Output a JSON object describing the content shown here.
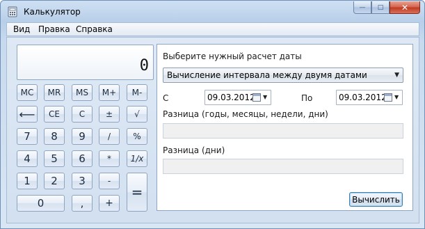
{
  "window": {
    "title": "Калькулятор",
    "caption": {
      "minimize": "—",
      "maximize": "□",
      "close": "✕"
    }
  },
  "menu": {
    "view": "Вид",
    "edit": "Правка",
    "help": "Справка"
  },
  "display": {
    "value": "0"
  },
  "keys": {
    "mc": "MC",
    "mr": "MR",
    "ms": "MS",
    "mplus": "M+",
    "mminus": "M-",
    "backspace": "⟵",
    "ce": "CE",
    "c": "C",
    "plusminus": "±",
    "sqrt": "√",
    "d7": "7",
    "d8": "8",
    "d9": "9",
    "divide": "/",
    "percent": "%",
    "d4": "4",
    "d5": "5",
    "d6": "6",
    "multiply": "*",
    "reciprocal": "1/x",
    "d1": "1",
    "d2": "2",
    "d3": "3",
    "minus": "-",
    "equals": "=",
    "d0": "0",
    "decimal": ",",
    "plus": "+"
  },
  "date_panel": {
    "select_label": "Выберите нужный расчет даты",
    "mode_selected": "Вычисление интервала между двумя датами",
    "from_label": "С",
    "from_date": "09.03.2012",
    "to_label": "По",
    "to_date": "09.03.2012",
    "diff_full_label": "Разница (годы, месяцы, недели, дни)",
    "diff_full_value": "",
    "diff_days_label": "Разница (дни)",
    "diff_days_value": "",
    "calculate_label": "Вычислить"
  }
}
